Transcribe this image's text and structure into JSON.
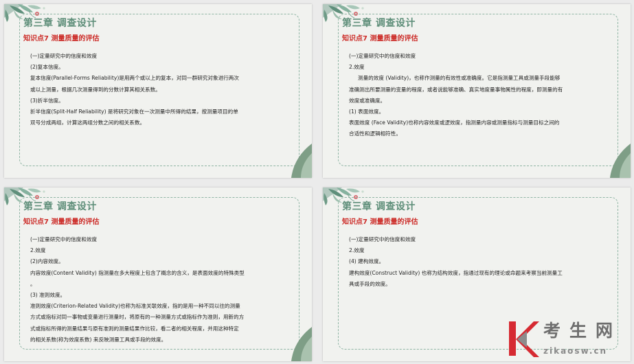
{
  "slides": [
    {
      "chapter": "第三章  调查设计",
      "subtitle": "知识点7  测量质量的评估",
      "lines": [
        "(一)定量研究中的信度和效度",
        "(2)复本信度。",
        "复本信度(Parallel-Forms Reliability)是用两个或以上的复本，对同一群研究对象进行两次",
        "或以上测量，根据几次测量得到的分数计算其相关系数。",
        "(3)折半信度。",
        "折半信度(Split-Half Reliability) 是将研究对象在一次测量中所得的结果，按测量项目的单",
        "双号分成两组，计算这两组分数之间的相关系数。"
      ]
    },
    {
      "chapter": "第三章  调查设计",
      "subtitle": "知识点7  测量质量的评估",
      "lines": [
        "(一)定量研究中的信度和效度",
        "2.效度",
        "测量的效度 (Validity)，也称作测量的有效性或准确度。它是指测量工具或测量手段能够",
        "准确测出所要测量的变量的程度，或者说能够准确、真实地度量事物属性的程度，即测量的有",
        "效度或准确度。",
        "(1) 表面效度。",
        "表面效度 (Face Validity)也称内容效度或逻效度，指测量内容或测量指标与测量目标之间的",
        "合适性和逻辑相符性。"
      ]
    },
    {
      "chapter": "第三章  调查设计",
      "subtitle": "知识点7  测量质量的评估",
      "lines": [
        "(一)定量研究中的信度和效度",
        "2.效度",
        "(2)内容效度。",
        "内容效度(Content Validity) 指测量在多大程度上包含了概念的含义，是表面效度的特殊类型",
        "。",
        "(3) 准则效度。",
        "准则效度(Criterion-Related Validity)也称为标准关联效度，指的是用一种不同以往的测量",
        "方式或指标对同一事物或变量进行测量时，将原有的一种测量方式或指标作为准则，用新的方",
        "式或指标所得的测量结果与原有准则的测量结果作比较，看二者的相关程度，并用这种特定",
        "的相关系数(称为效度系数) 来反映测量工具或手段的效度。"
      ]
    },
    {
      "chapter": "第三章  调查设计",
      "subtitle": "知识点7  测量质量的评估",
      "lines": [
        "(一)定量研究中的信度和效度",
        "2.效度",
        "(4) 建构效度。",
        "建构效度(Construct Validity) 也称为结构效度，指通过现有的理论或命题来考察当前测量工",
        "具或手段的效度。"
      ]
    }
  ],
  "watermark": {
    "title": "考生网",
    "url": "zikaosw.cn"
  },
  "colors": {
    "slide_bg": "#f1f2ef",
    "chapter": "#5e8e79",
    "subtitle": "#cc2a26",
    "frame": "#8fb5a4",
    "logo_red": "#d62a32"
  }
}
